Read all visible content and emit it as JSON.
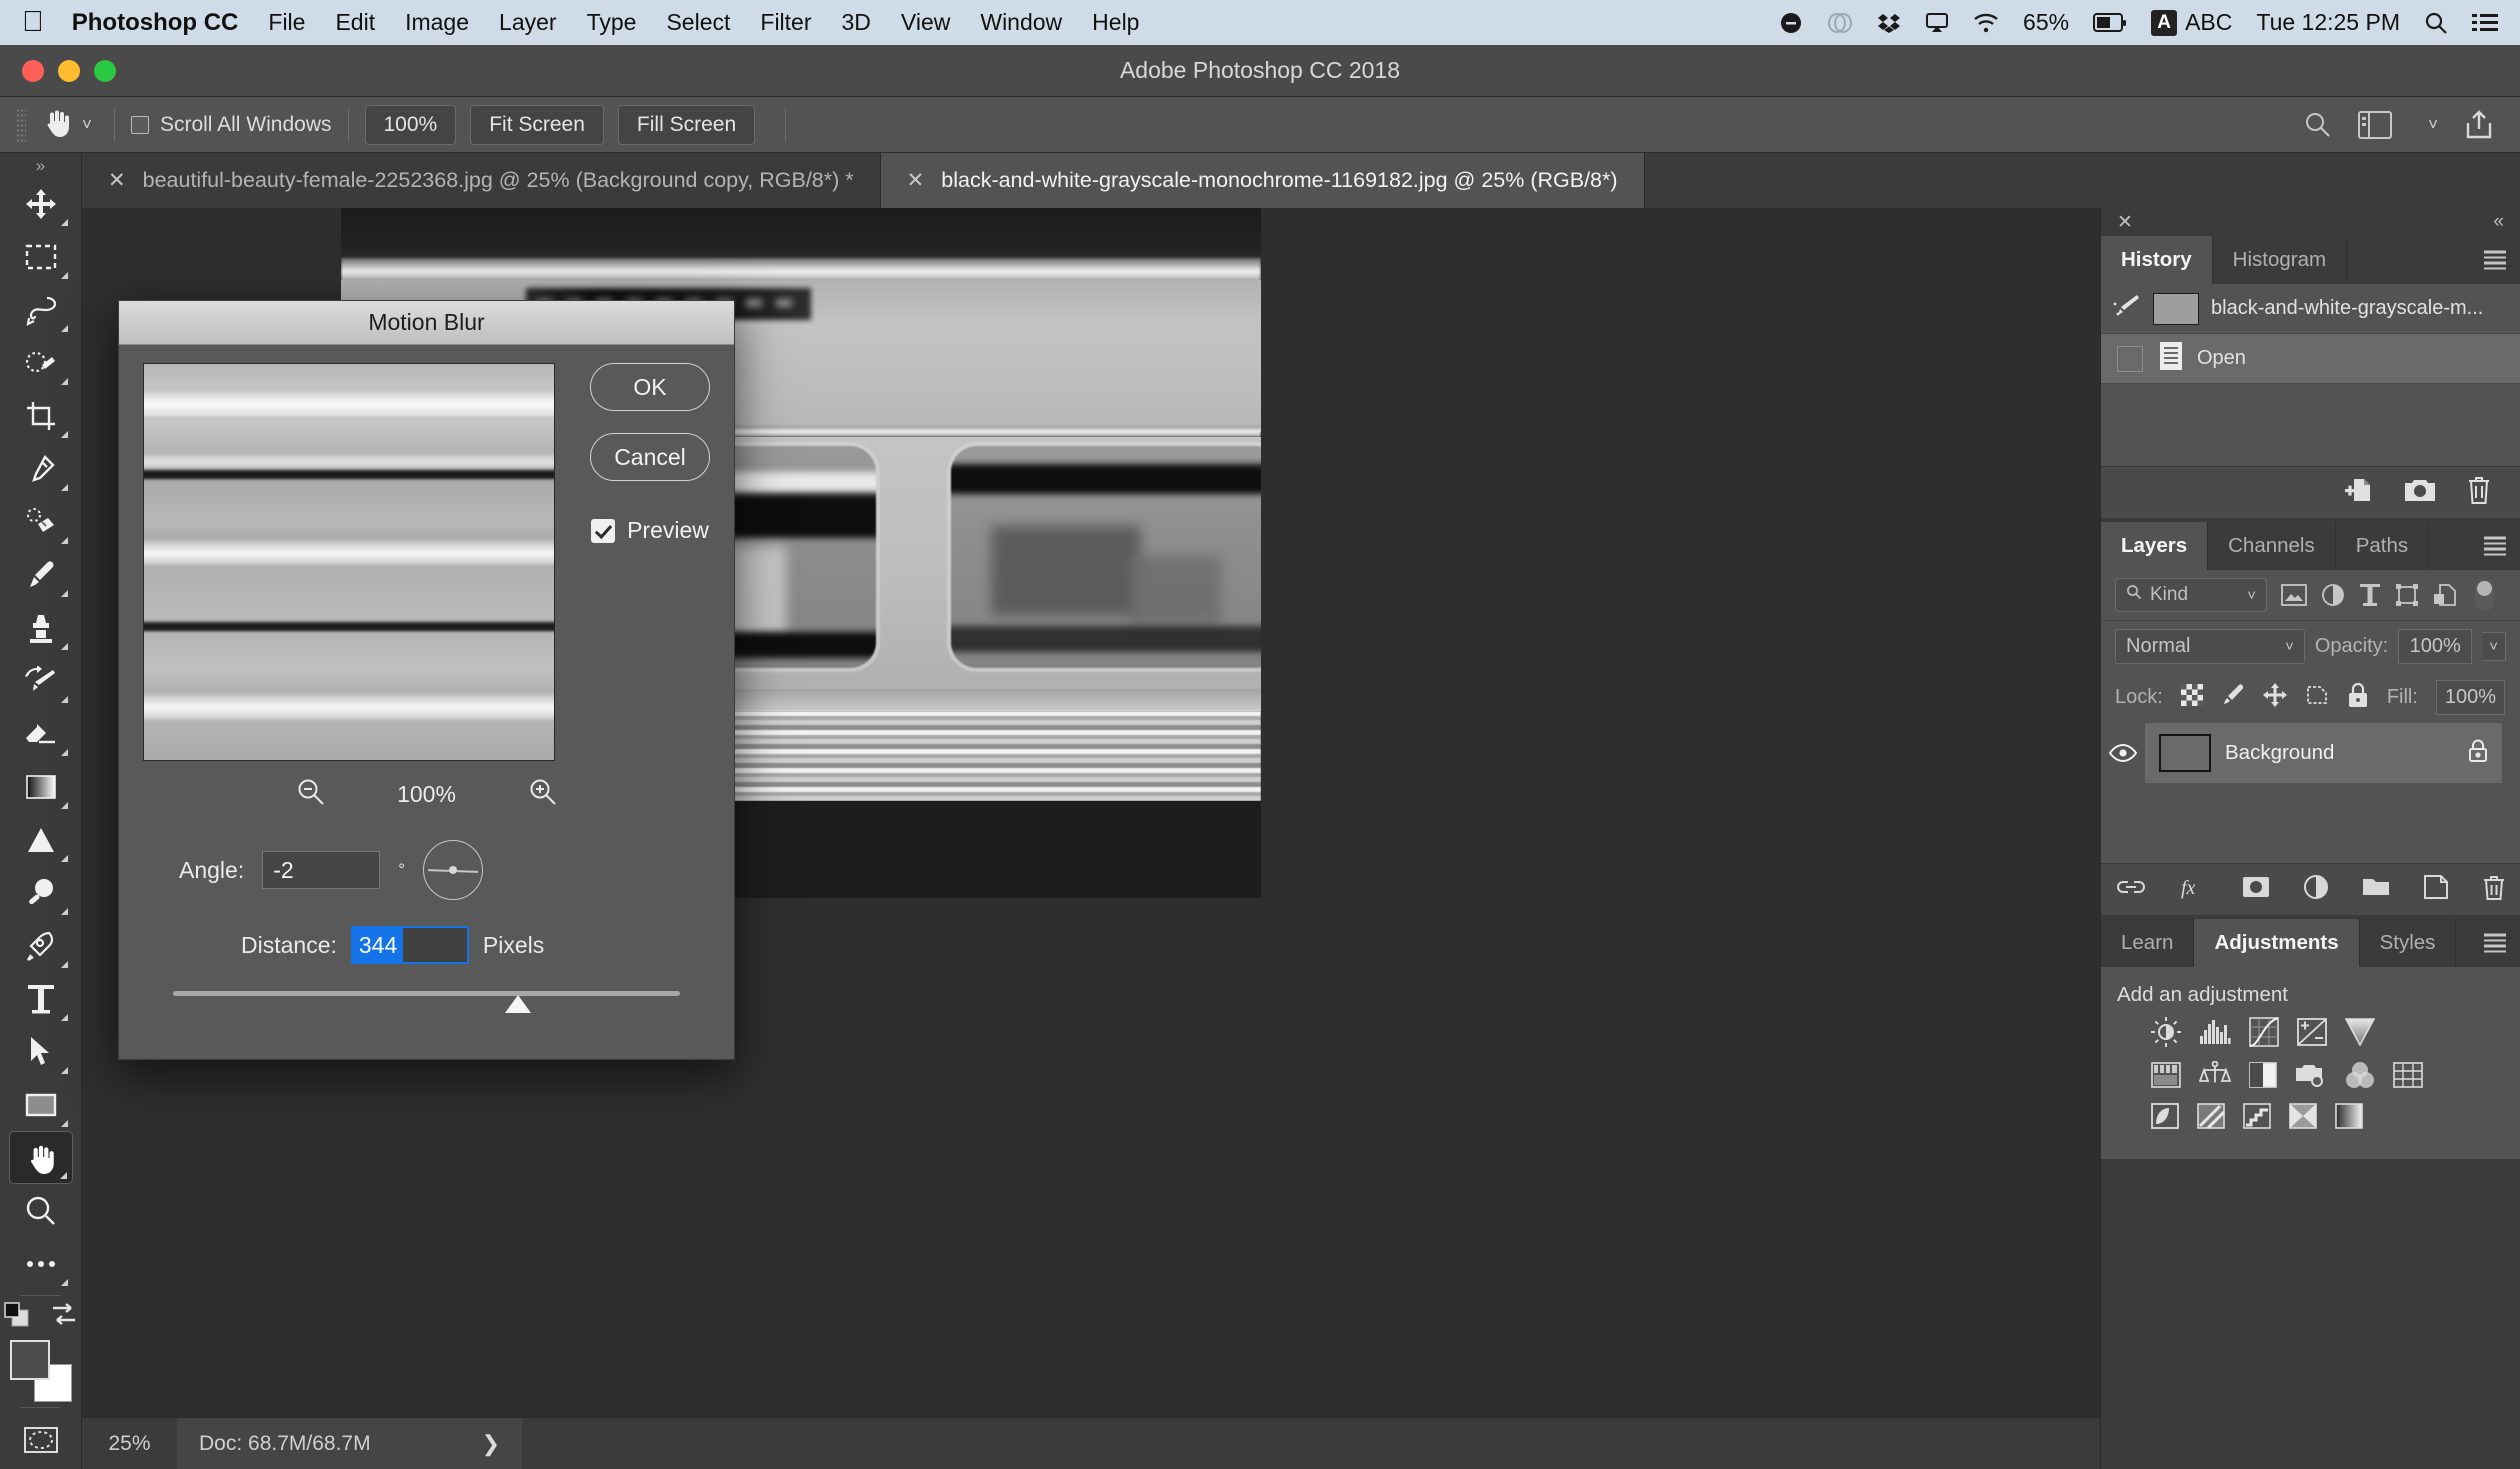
{
  "macbar": {
    "apple_icon": "apple-icon",
    "app_name": "Photoshop CC",
    "menus": [
      "File",
      "Edit",
      "Image",
      "Layer",
      "Type",
      "Select",
      "Filter",
      "3D",
      "View",
      "Window",
      "Help"
    ],
    "status_icons": [
      "dnd-icon",
      "creative-cloud-icon",
      "dropbox-icon",
      "airplay-icon",
      "wifi-icon"
    ],
    "battery_percent": "65%",
    "input_source_badge": "A",
    "input_source_label": "ABC",
    "clock": "Tue 12:25 PM",
    "spotlight_icon": "search-icon",
    "notification_icon": "notification-center-icon"
  },
  "window": {
    "title": "Adobe Photoshop CC 2018",
    "traffic_lights": {
      "close": "#ff5f57",
      "minimize": "#febc2e",
      "zoom": "#28c840"
    }
  },
  "options_bar": {
    "tool_icon": "hand-tool-icon",
    "preset_chevron": "chevron-down-icon",
    "scroll_all_windows_label": "Scroll All Windows",
    "scroll_all_windows_checked": false,
    "buttons": [
      "100%",
      "Fit Screen",
      "Fill Screen"
    ],
    "right_icons": [
      "search-icon",
      "workspace-icon",
      "chevron-down-icon",
      "share-icon"
    ]
  },
  "document_tabs": [
    {
      "label": "beautiful-beauty-female-2252368.jpg @ 25% (Background copy, RGB/8*) *",
      "active": false,
      "close_icon": "close-icon"
    },
    {
      "label": "black-and-white-grayscale-monochrome-1169182.jpg @ 25% (RGB/8*)",
      "active": true,
      "close_icon": "close-icon"
    }
  ],
  "toolbar": {
    "expand_icon": "chevron-double-right-icon",
    "tools": [
      {
        "name": "move-tool",
        "active": false
      },
      {
        "name": "rectangular-marquee-tool",
        "active": false
      },
      {
        "name": "lasso-tool",
        "active": false
      },
      {
        "name": "quick-selection-tool",
        "active": false
      },
      {
        "name": "crop-tool",
        "active": false
      },
      {
        "name": "eyedropper-tool",
        "active": false
      },
      {
        "name": "spot-healing-brush-tool",
        "active": false
      },
      {
        "name": "brush-tool",
        "active": false
      },
      {
        "name": "clone-stamp-tool",
        "active": false
      },
      {
        "name": "history-brush-tool",
        "active": false
      },
      {
        "name": "eraser-tool",
        "active": false
      },
      {
        "name": "gradient-tool",
        "active": false
      },
      {
        "name": "blur-tool",
        "active": false
      },
      {
        "name": "dodge-tool",
        "active": false
      },
      {
        "name": "pen-tool",
        "active": false
      },
      {
        "name": "type-tool",
        "active": false
      },
      {
        "name": "path-selection-tool",
        "active": false
      },
      {
        "name": "rectangle-tool",
        "active": false
      },
      {
        "name": "hand-tool",
        "active": true
      },
      {
        "name": "zoom-tool",
        "active": false
      },
      {
        "name": "edit-toolbar-tool",
        "active": false
      }
    ],
    "swap_colors_icon": "swap-colors-icon",
    "default_colors_icon": "default-colors-icon",
    "quick_mask_icon": "quick-mask-icon"
  },
  "status_bar": {
    "zoom": "25%",
    "doc_size": "Doc: 68.7M/68.7M",
    "expand_icon": "chevron-right-icon"
  },
  "panels": {
    "close_icon": "close-icon",
    "collapse_icon": "double-chevron-left-icon",
    "history": {
      "tabs": [
        {
          "label": "History",
          "active": true
        },
        {
          "label": "Histogram",
          "active": false
        }
      ],
      "menu_icon": "panel-menu-icon",
      "states": [
        {
          "label": "black-and-white-grayscale-m...",
          "icon": "history-brush-icon",
          "has_thumb": true,
          "selected": false
        },
        {
          "label": "Open",
          "icon": "document-icon",
          "has_thumb": false,
          "selected": true
        }
      ],
      "footer_icons": [
        "new-document-from-state-icon",
        "new-snapshot-icon",
        "delete-icon"
      ]
    },
    "layers": {
      "tabs": [
        {
          "label": "Layers",
          "active": true
        },
        {
          "label": "Channels",
          "active": false
        },
        {
          "label": "Paths",
          "active": false
        }
      ],
      "menu_icon": "panel-menu-icon",
      "filter_label": "Kind",
      "filter_search_icon": "search-icon",
      "filter_icons": [
        "filter-pixel-icon",
        "filter-adjustment-icon",
        "filter-type-icon",
        "filter-shape-icon",
        "filter-smart-object-icon"
      ],
      "filter_toggle": "filter-enable-toggle",
      "blend_mode": "Normal",
      "opacity_label": "Opacity:",
      "opacity_value": "100%",
      "lock_label": "Lock:",
      "lock_icons": [
        "lock-transparent-pixels-icon",
        "lock-image-pixels-icon",
        "lock-position-icon",
        "lock-artboard-icon",
        "lock-all-icon"
      ],
      "fill_label": "Fill:",
      "fill_value": "100%",
      "items": [
        {
          "name": "Background",
          "visible": true,
          "locked": true,
          "selected": true,
          "eye_icon": "eye-icon",
          "lock_icon": "lock-icon"
        }
      ],
      "footer_icons": [
        "link-layers-icon",
        "layer-style-fx-icon",
        "add-layer-mask-icon",
        "new-adjustment-layer-icon",
        "new-group-icon",
        "new-layer-icon",
        "delete-layer-icon"
      ]
    },
    "adjustments": {
      "tabs": [
        {
          "label": "Learn",
          "active": false
        },
        {
          "label": "Adjustments",
          "active": true
        },
        {
          "label": "Styles",
          "active": false
        }
      ],
      "menu_icon": "panel-menu-icon",
      "heading": "Add an adjustment",
      "rows": [
        [
          "brightness-contrast-icon",
          "levels-icon",
          "curves-icon",
          "exposure-icon",
          "vibrance-icon"
        ],
        [
          "hue-saturation-icon",
          "color-balance-icon",
          "black-white-icon",
          "photo-filter-icon",
          "channel-mixer-icon",
          "color-lookup-icon"
        ],
        [
          "invert-icon",
          "posterize-icon",
          "threshold-icon",
          "gradient-map-icon",
          "selective-color-icon"
        ]
      ]
    }
  },
  "dialog": {
    "title": "Motion Blur",
    "ok_label": "OK",
    "cancel_label": "Cancel",
    "preview_label": "Preview",
    "preview_checked": true,
    "zoom_out_icon": "zoom-out-icon",
    "zoom_in_icon": "zoom-in-icon",
    "zoom_level": "100%",
    "angle_label": "Angle:",
    "angle_value": "-2",
    "angle_unit": "°",
    "angle_dial_icon": "angle-dial-icon",
    "distance_label": "Distance:",
    "distance_value": "344",
    "distance_unit": "Pixels",
    "distance_selected": true,
    "selection_color": "#1473e6",
    "slider_position_pct": 68
  }
}
